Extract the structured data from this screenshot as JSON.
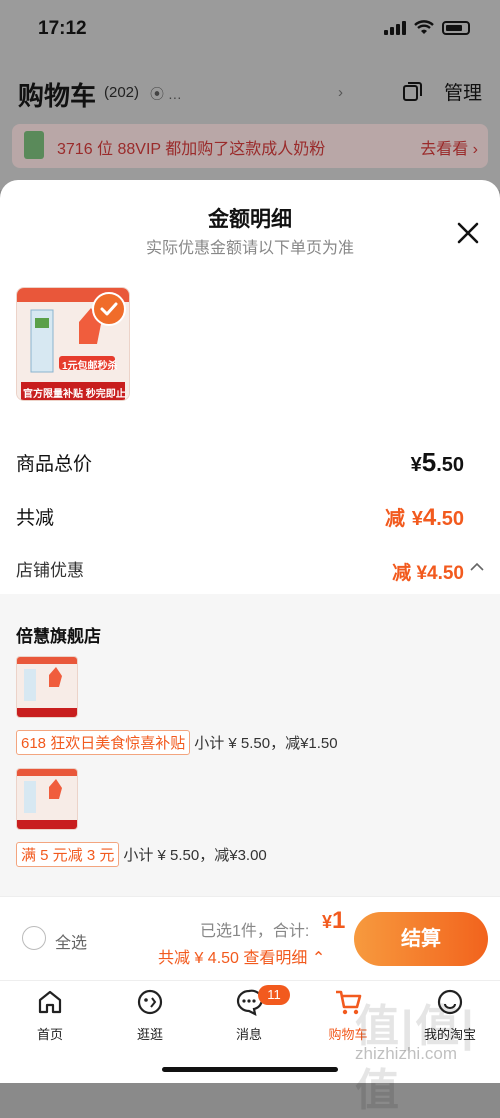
{
  "status_bar": {
    "time": "17:12"
  },
  "header": {
    "title": "购物车",
    "count": "(202)",
    "location": "…",
    "manage": "管理"
  },
  "banner": {
    "text": "3716 位 88VIP 都加购了这款成人奶粉",
    "link": "去看看"
  },
  "sheet": {
    "title": "金额明细",
    "subtitle": "实际优惠金额请以下单页为准",
    "product_image_text": {
      "slogan": "1元包邮秒杀",
      "footer": "官方限量补贴 秒完即止"
    },
    "rows": {
      "total_label": "商品总价",
      "total_currency": "¥",
      "total_int": "5",
      "total_dec": ".50",
      "reduce_label": "共减",
      "reduce_prefix": "减",
      "reduce_currency": "¥",
      "reduce_int": "4",
      "reduce_dec": ".50",
      "shop_disc_label": "店铺优惠",
      "shop_disc_value": "减 ¥4.50"
    },
    "shop": {
      "name": "倍慧旗舰店",
      "promos": [
        {
          "tag": "618 狂欢日美食惊喜补贴",
          "detail": "小计 ¥ 5.50，减¥1.50"
        },
        {
          "tag": "满 5 元减 3 元",
          "detail": "小计 ¥ 5.50，减¥3.00"
        }
      ]
    }
  },
  "bottom_bar": {
    "select_all": "全选",
    "selected_info": "已选1件，合计:",
    "total_currency": "¥",
    "total_value": "1",
    "reduce_info": "共减 ¥ 4.50  查看明细",
    "checkout": "结算"
  },
  "tabbar": {
    "items": [
      {
        "label": "首页",
        "icon": "home-icon"
      },
      {
        "label": "逛逛",
        "icon": "browse-icon"
      },
      {
        "label": "消息",
        "icon": "message-icon",
        "badge": "11"
      },
      {
        "label": "购物车",
        "icon": "cart-icon",
        "active": true
      },
      {
        "label": "我的淘宝",
        "icon": "profile-icon"
      }
    ]
  },
  "watermark": {
    "logo": "值|值|值",
    "url": "zhizhizhi.com"
  },
  "colors": {
    "accent": "#f25a1e",
    "checkout_start": "#f79a3e",
    "checkout_end": "#f2631d"
  }
}
